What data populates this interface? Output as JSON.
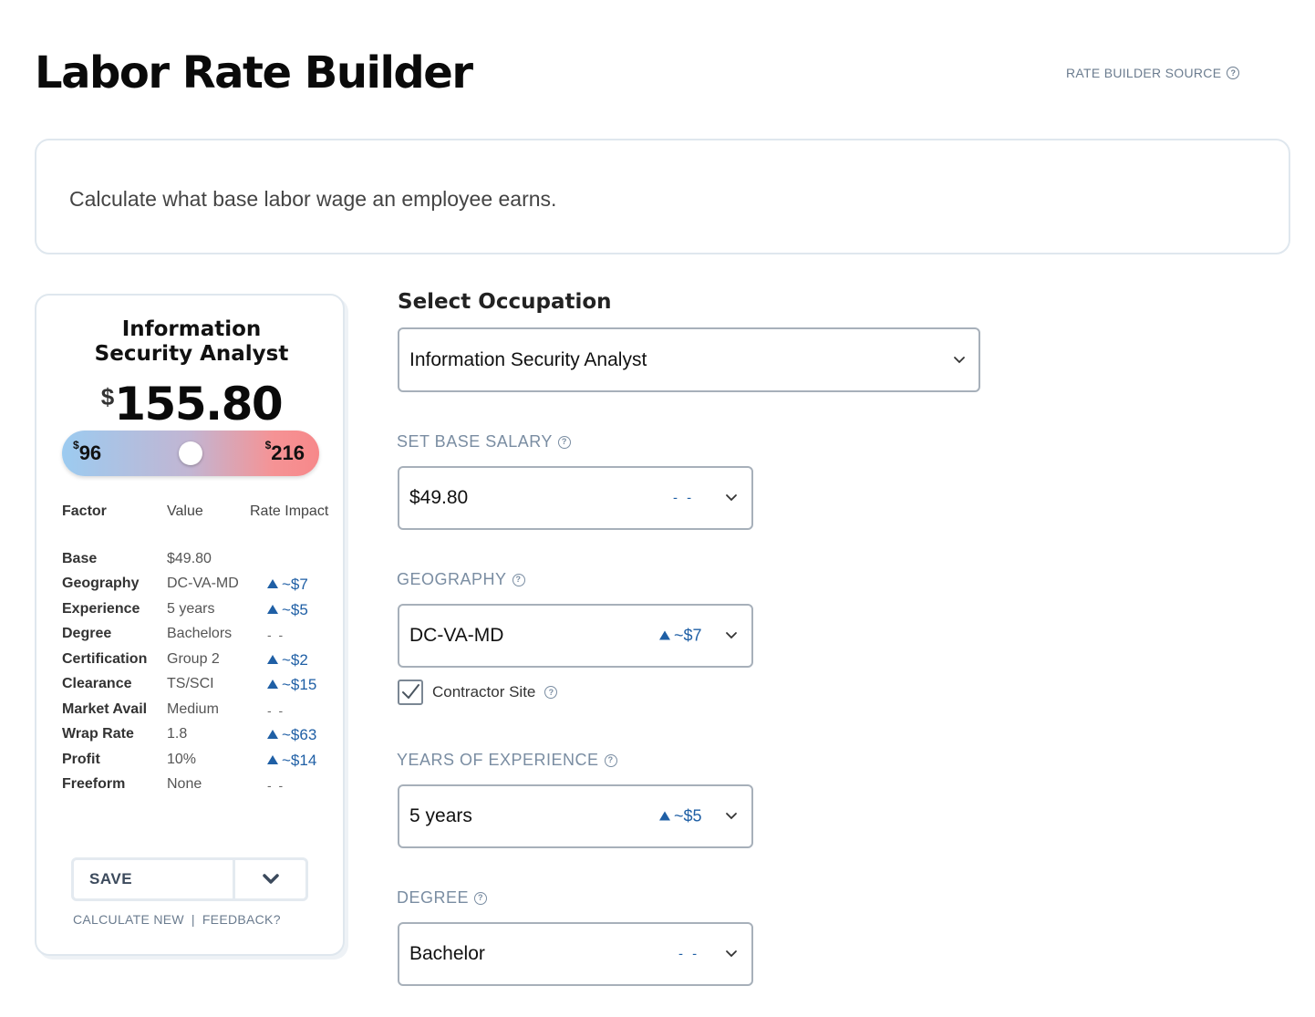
{
  "header": {
    "title": "Labor Rate Builder",
    "source_link": "RATE BUILDER SOURCE"
  },
  "intro": {
    "text": "Calculate what base labor wage an employee earns."
  },
  "summary": {
    "title_line1": "Information",
    "title_line2": "Security Analyst",
    "currency": "$",
    "rate": "155.80",
    "range_min_currency": "$",
    "range_min": "96",
    "range_max_currency": "$",
    "range_max": "216",
    "range_position_fraction": 0.5,
    "columns": {
      "factor": "Factor",
      "value": "Value",
      "impact": "Rate Impact"
    },
    "factors": [
      {
        "name": "Base",
        "value": "$49.80",
        "impact": "",
        "direction": "none"
      },
      {
        "name": "Geography",
        "value": "DC-VA-MD",
        "impact": "~$7",
        "direction": "up"
      },
      {
        "name": "Experience",
        "value": "5 years",
        "impact": "~$5",
        "direction": "up"
      },
      {
        "name": "Degree",
        "value": "Bachelors",
        "impact": "- -",
        "direction": "none"
      },
      {
        "name": "Certification",
        "value": "Group 2",
        "impact": "~$2",
        "direction": "up"
      },
      {
        "name": "Clearance",
        "value": "TS/SCI",
        "impact": "~$15",
        "direction": "up"
      },
      {
        "name": "Market Avail",
        "value": "Medium",
        "impact": "- -",
        "direction": "none"
      },
      {
        "name": "Wrap Rate",
        "value": "1.8",
        "impact": "~$63",
        "direction": "up"
      },
      {
        "name": "Profit",
        "value": "10%",
        "impact": "~$14",
        "direction": "up"
      },
      {
        "name": "Freeform",
        "value": "None",
        "impact": "- -",
        "direction": "none"
      }
    ],
    "save_label": "SAVE",
    "calculate_new_label": "CALCULATE NEW",
    "separator": "|",
    "feedback_label": "FEEDBACK?"
  },
  "form": {
    "occupation_title": "Select Occupation",
    "occupation_value": "Information Security Analyst",
    "base_salary_label": "SET BASE SALARY",
    "base_salary_value": "$49.80",
    "base_salary_impact": "- -",
    "geography_label": "GEOGRAPHY",
    "geography_value": "DC-VA-MD",
    "geography_impact": "~$7",
    "contractor_site_label": "Contractor Site",
    "contractor_site_checked": true,
    "experience_label": "YEARS OF EXPERIENCE",
    "experience_value": "5 years",
    "experience_impact": "~$5",
    "degree_label": "DEGREE",
    "degree_value": "Bachelor",
    "degree_impact": "- -"
  },
  "colors": {
    "accent_blue": "#1f5fa5",
    "label_gray": "#7a8da2",
    "border": "#a7b0ba",
    "range_low": "#9ccbf0",
    "range_high": "#f6888a"
  }
}
